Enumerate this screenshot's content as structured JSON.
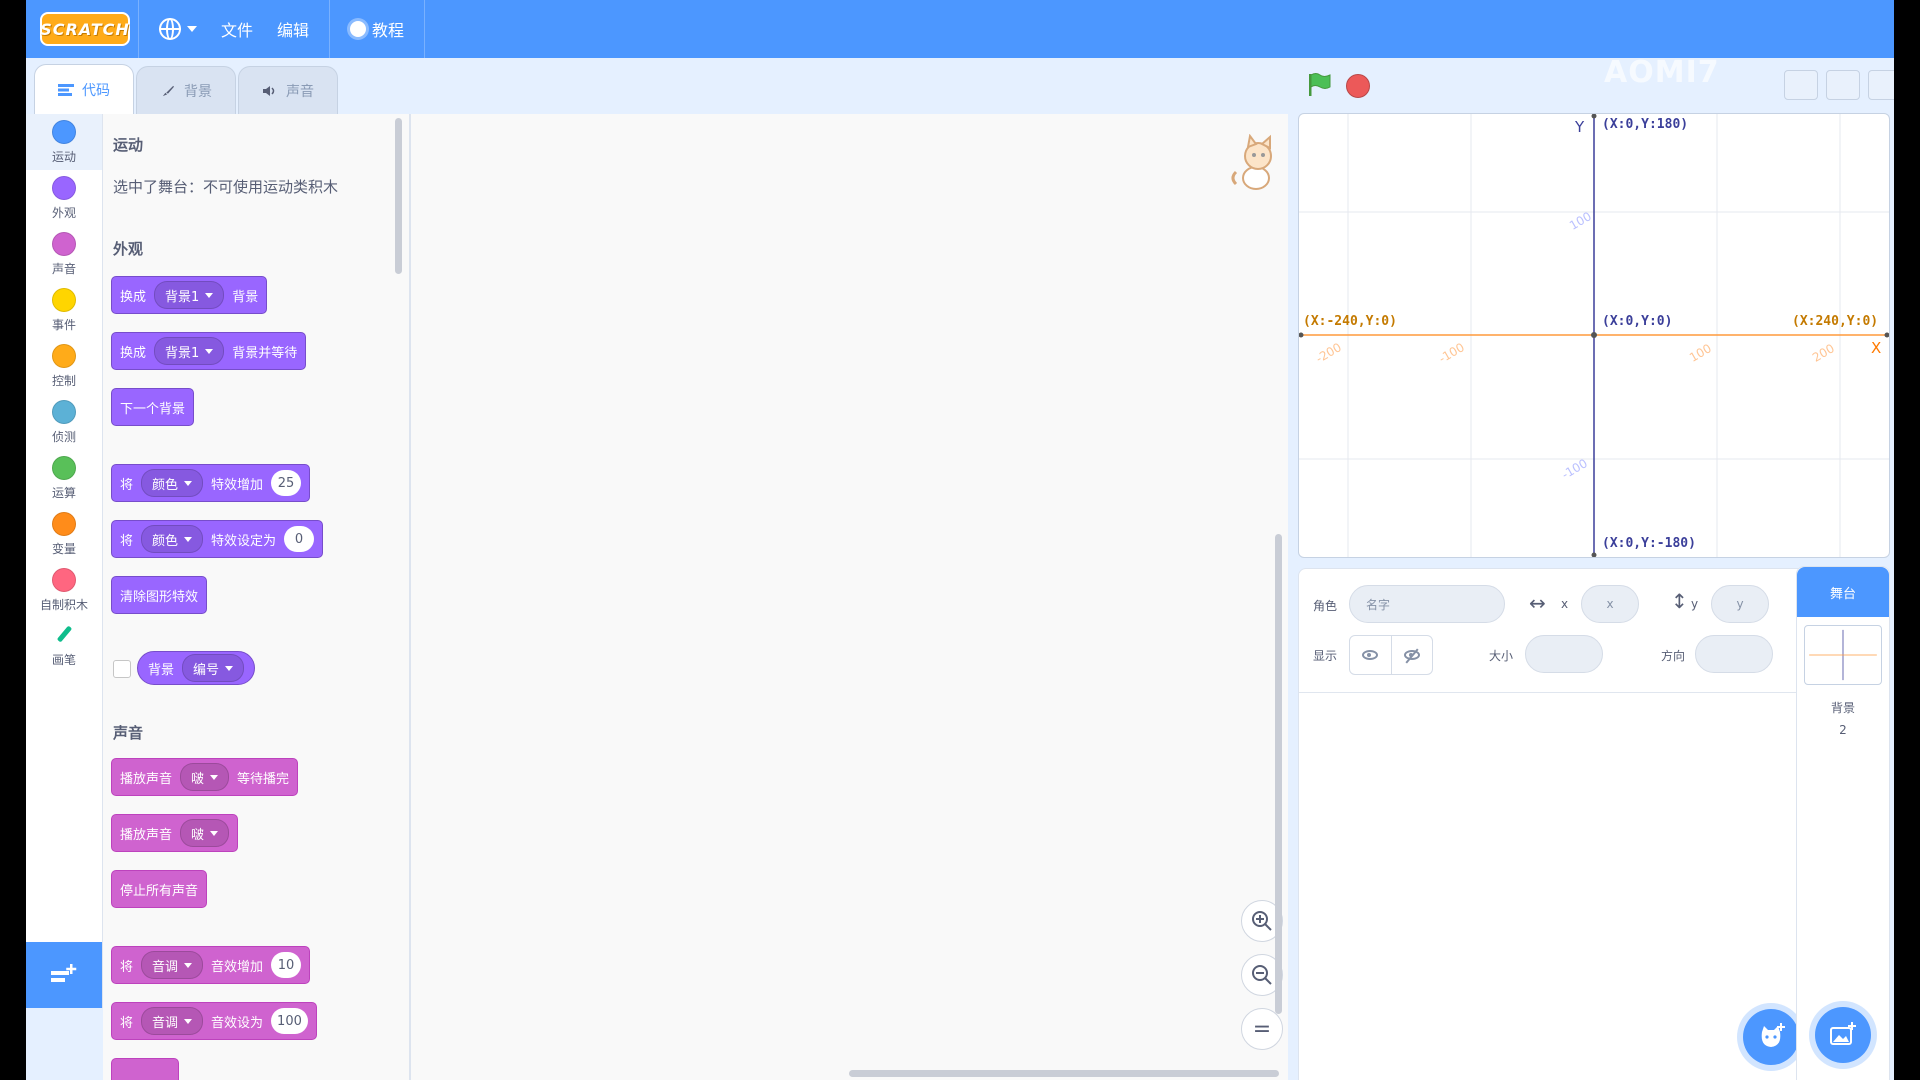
{
  "menubar": {
    "logo": "SCRATCH",
    "file": "文件",
    "edit": "编辑",
    "tutorials": "教程"
  },
  "tabs": [
    {
      "label": "代码",
      "active": true
    },
    {
      "label": "背景",
      "active": false
    },
    {
      "label": "声音",
      "active": false
    }
  ],
  "categories": [
    {
      "label": "运动",
      "color": "#4c97ff"
    },
    {
      "label": "外观",
      "color": "#9966ff"
    },
    {
      "label": "声音",
      "color": "#cf63cf"
    },
    {
      "label": "事件",
      "color": "#ffd500"
    },
    {
      "label": "控制",
      "color": "#ffab19"
    },
    {
      "label": "侦测",
      "color": "#5cb1d6"
    },
    {
      "label": "运算",
      "color": "#59c059"
    },
    {
      "label": "变量",
      "color": "#ff8c1a"
    },
    {
      "label": "自制积木",
      "color": "#ff6680"
    },
    {
      "label": "画笔",
      "color": "#0fbd8c"
    }
  ],
  "palette": {
    "motion_heading": "运动",
    "motion_note": "选中了舞台：不可使用运动类积木",
    "looks_heading": "外观",
    "sound_heading": "声音",
    "looks_blocks": {
      "b1": {
        "pre": "换成",
        "drop": "背景1",
        "post": "背景"
      },
      "b2": {
        "pre": "换成",
        "drop": "背景1",
        "post": "背景并等待"
      },
      "b3": {
        "pre": "下一个背景"
      },
      "b4": {
        "pre": "将",
        "drop": "颜色",
        "post": "特效增加",
        "value": "25"
      },
      "b5": {
        "pre": "将",
        "drop": "颜色",
        "post": "特效设定为",
        "value": "0"
      },
      "b6": {
        "pre": "清除图形特效"
      },
      "r1": {
        "pre": "背景",
        "drop": "编号"
      }
    },
    "sound_blocks": {
      "b1": {
        "pre": "播放声音",
        "drop": "啵",
        "post": "等待播完"
      },
      "b2": {
        "pre": "播放声音",
        "drop": "啵"
      },
      "b3": {
        "pre": "停止所有声音"
      },
      "b4": {
        "pre": "将",
        "drop": "音调",
        "post": "音效增加",
        "value": "10"
      },
      "b5": {
        "pre": "将",
        "drop": "音调",
        "post": "音效设为",
        "value": "100"
      }
    }
  },
  "zoom": {
    "in": "+",
    "out": "−",
    "reset": "="
  },
  "watermark": "AOMI7",
  "stage": {
    "y_label": "Y",
    "x_label": "X",
    "top": "(X:0,Y:180)",
    "bottom": "(X:0,Y:-180)",
    "left": "(X:-240,Y:0)",
    "right": "(X:240,Y:0)",
    "origin": "(X:0,Y:0)",
    "ticks": {
      "x_m200": "-200",
      "x_m100": "-100",
      "x_100": "100",
      "x_200": "200",
      "y_100": "100",
      "y_m100": "-100"
    }
  },
  "sprite_info": {
    "sprite_label": "角色",
    "name_placeholder": "名字",
    "x_label": "x",
    "x_placeholder": "x",
    "y_label": "y",
    "y_placeholder": "y",
    "show_label": "显示",
    "size_label": "大小",
    "direction_label": "方向"
  },
  "stage_panel": {
    "title": "舞台",
    "backdrops_label": "背景",
    "backdrops_count": "2"
  }
}
